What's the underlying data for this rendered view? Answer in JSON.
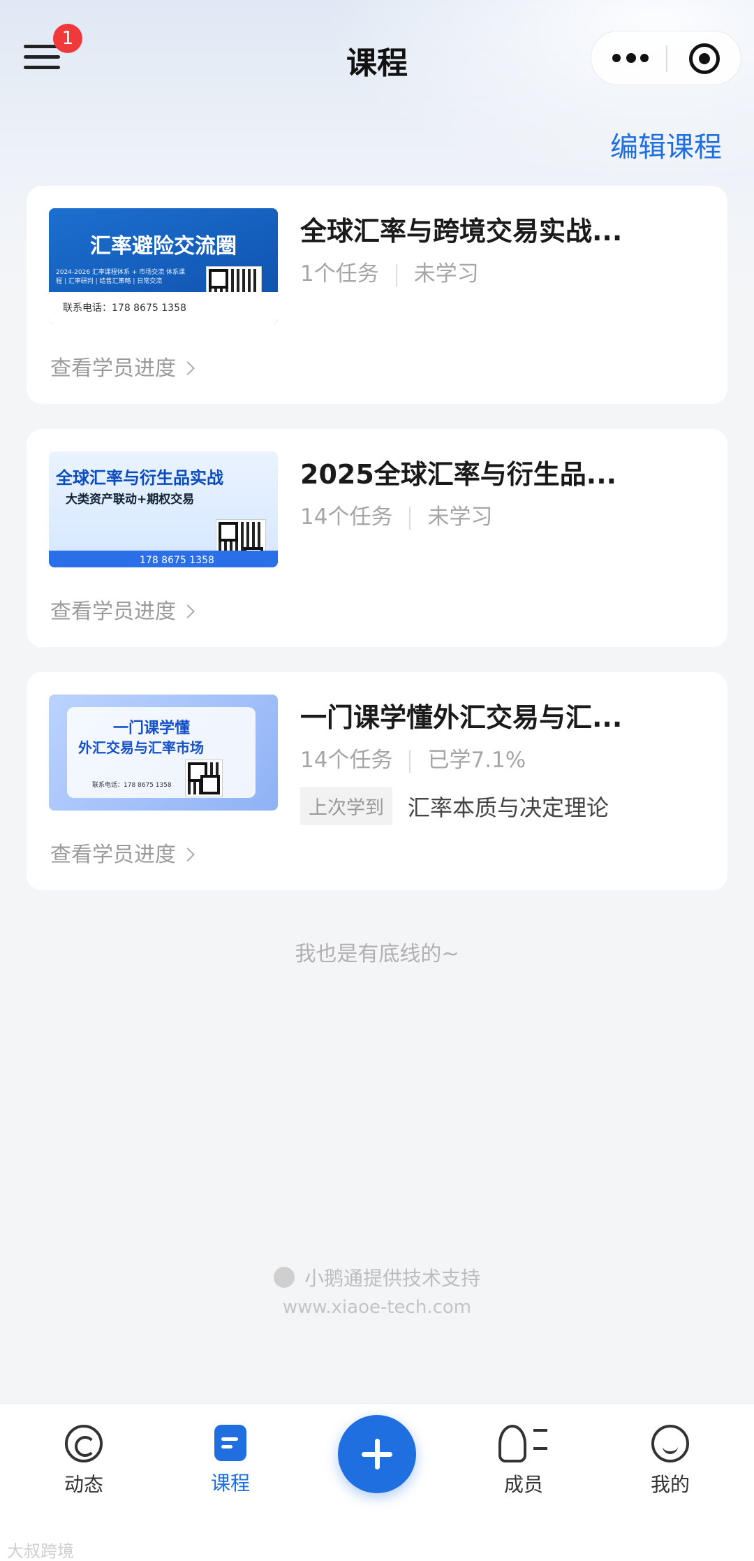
{
  "header": {
    "title": "课程",
    "menu_badge": "1",
    "edit_label": "编辑课程"
  },
  "courses": [
    {
      "title": "全球汇率与跨境交易实战...",
      "tasks": "1个任务",
      "status": "未学习",
      "progress_link": "查看学员进度",
      "cover": {
        "headline": "汇率避险交流圈",
        "phone": "联系电话：178 8675 1358",
        "sub": "2024-2026 汇率课程体系 + 市场交流 体系课程 | 汇率研判 | 结售汇策略 | 日常交流"
      }
    },
    {
      "title": "2025全球汇率与衍生品...",
      "tasks": "14个任务",
      "status": "未学习",
      "progress_link": "查看学员进度",
      "cover": {
        "headline": "全球汇率与衍生品实战",
        "subhead": "大类资产联动+期权交易",
        "phone": "178 8675 1358"
      }
    },
    {
      "title": "一门课学懂外汇交易与汇...",
      "tasks": "14个任务",
      "status": "已学7.1%",
      "last_tag": "上次学到",
      "last_text": "汇率本质与决定理论",
      "progress_link": "查看学员进度",
      "cover": {
        "headline": "一门课学懂",
        "subhead": "外汇交易与汇率市场",
        "phone": "联系电话：178 8675 1358"
      }
    }
  ],
  "footer": {
    "end_text": "我也是有底线的~",
    "powered": "小鹅通提供技术支持",
    "website": "www.xiaoe-tech.com"
  },
  "tabbar": {
    "feed": "动态",
    "course": "课程",
    "member": "成员",
    "me": "我的"
  },
  "watermark": "大叔跨境"
}
